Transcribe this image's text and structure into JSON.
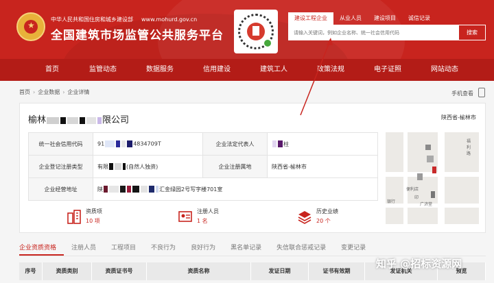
{
  "header": {
    "ministry": "中华人民共和国住房和城乡建设部",
    "ministry_url": "www.mohurd.gov.cn",
    "title": "全国建筑市场监管公共服务平台"
  },
  "search": {
    "tabs": [
      "建设工程企业",
      "从业人员",
      "建设项目",
      "诚信记录"
    ],
    "placeholder": "请输入关键词，例如企业名称、统一社会信用代码",
    "button": "搜索"
  },
  "nav": [
    "首页",
    "监管动态",
    "数据服务",
    "信用建设",
    "建筑工人",
    "政策法规",
    "电子证照",
    "网站动态"
  ],
  "breadcrumb": [
    "首页",
    "企业数据",
    "企业详情"
  ],
  "mobile_view": "手机查看",
  "company": {
    "name_prefix": "榆林",
    "name_suffix": "限公司",
    "region": "陕西省-榆林市",
    "fields": {
      "credit_code_label": "统一社会信用代码",
      "credit_code_value": "4834709T",
      "credit_code_prefix": "91",
      "legal_rep_label": "企业法定代表人",
      "legal_rep_value": "柱",
      "reg_type_label": "企业登记注册类型",
      "reg_type_value": "(自然人独资)",
      "reg_type_prefix": "有限",
      "reg_place_label": "企业注册属地",
      "reg_place_value": "陕西省-榆林市",
      "address_label": "企业经营地址",
      "address_prefix": "陕",
      "address_value": "汇金绿园2号写字楼701室"
    }
  },
  "stats": [
    {
      "label": "资质项",
      "value": "10 项"
    },
    {
      "label": "注册人员",
      "value": "1 名"
    },
    {
      "label": "历史业绩",
      "value": "20 个"
    }
  ],
  "map": {
    "labels": [
      "福",
      "利",
      "路",
      "便利店",
      "印",
      "广济堂",
      "银行"
    ]
  },
  "tabs": [
    "企业资质资格",
    "注册人员",
    "工程项目",
    "不良行为",
    "良好行为",
    "黑名单记录",
    "失信联合惩戒记录",
    "变更记录"
  ],
  "table_headers": [
    "序号",
    "资质类别",
    "资质证书号",
    "资质名称",
    "发证日期",
    "证书有效期",
    "发证机关",
    "预览"
  ],
  "watermark": "知乎 @招标资源网",
  "colors": {
    "brand": "#c8241e",
    "nav": "#b31c17"
  }
}
